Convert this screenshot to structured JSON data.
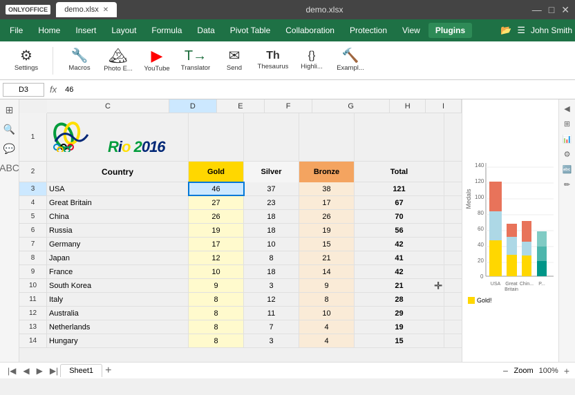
{
  "titlebar": {
    "logo": "ONLYOFFICE",
    "tab_label": "demo.xlsx",
    "title": "demo.xlsx",
    "min": "—",
    "max": "□",
    "close": "✕"
  },
  "menubar": {
    "items": [
      "File",
      "Home",
      "Insert",
      "Layout",
      "Formula",
      "Data",
      "Pivot Table",
      "Collaboration",
      "Protection",
      "View",
      "Plugins"
    ],
    "active": "Plugins",
    "user": "John Smith"
  },
  "toolbar": {
    "buttons": [
      {
        "name": "settings",
        "icon": "⚙",
        "label": "Settings"
      },
      {
        "name": "macros",
        "icon": "🔧",
        "label": "Macros"
      },
      {
        "name": "photo-editor",
        "icon": "🖼",
        "label": "Photo E..."
      },
      {
        "name": "youtube",
        "icon": "▶",
        "label": "YouTube"
      },
      {
        "name": "translator",
        "icon": "T→",
        "label": "Translator"
      },
      {
        "name": "send",
        "icon": "✉",
        "label": "Send"
      },
      {
        "name": "thesaurus",
        "icon": "Th",
        "label": "Thesaurus"
      },
      {
        "name": "highlight",
        "icon": "{}",
        "label": "Highli..."
      },
      {
        "name": "example",
        "icon": "🔨",
        "label": "Exampl..."
      }
    ]
  },
  "formula_bar": {
    "cell_ref": "D3",
    "fx": "fx",
    "formula": "46"
  },
  "columns": {
    "headers": [
      "C",
      "D",
      "E",
      "F",
      "G",
      "H",
      "I"
    ],
    "widths": [
      205,
      80,
      80,
      80,
      80,
      60,
      60
    ]
  },
  "rows": [
    {
      "num": "1",
      "special": "logo"
    },
    {
      "num": "2",
      "special": "header",
      "cells": [
        "Country",
        "Gold",
        "Silver",
        "Bronze",
        "Total"
      ]
    },
    {
      "num": "3",
      "cells": [
        "USA",
        "46",
        "37",
        "38",
        "121"
      ]
    },
    {
      "num": "4",
      "cells": [
        "Great Britain",
        "27",
        "23",
        "17",
        "67"
      ]
    },
    {
      "num": "5",
      "cells": [
        "China",
        "26",
        "18",
        "26",
        "70"
      ]
    },
    {
      "num": "6",
      "cells": [
        "Russia",
        "19",
        "18",
        "19",
        "56"
      ]
    },
    {
      "num": "7",
      "cells": [
        "Germany",
        "17",
        "10",
        "15",
        "42"
      ]
    },
    {
      "num": "8",
      "cells": [
        "Japan",
        "12",
        "8",
        "21",
        "41"
      ]
    },
    {
      "num": "9",
      "cells": [
        "France",
        "10",
        "18",
        "14",
        "42"
      ]
    },
    {
      "num": "10",
      "cells": [
        "South Korea",
        "9",
        "3",
        "9",
        "21"
      ]
    },
    {
      "num": "11",
      "cells": [
        "Italy",
        "8",
        "12",
        "8",
        "28"
      ]
    },
    {
      "num": "12",
      "cells": [
        "Australia",
        "8",
        "11",
        "10",
        "29"
      ]
    },
    {
      "num": "13",
      "cells": [
        "Netherlands",
        "8",
        "7",
        "4",
        "19"
      ]
    },
    {
      "num": "14",
      "cells": [
        "Hungary",
        "8",
        "3",
        "4",
        "15"
      ]
    }
  ],
  "sheet_tab": "Sheet1",
  "zoom": "100%",
  "chart": {
    "title": "Medals",
    "y_max": 140,
    "y_labels": [
      "0",
      "20",
      "40",
      "60",
      "80",
      "100",
      "120",
      "140"
    ],
    "x_labels": [
      "USA",
      "Great Britain",
      "Chin...",
      "P..."
    ],
    "legend": [
      "Gold!",
      ""
    ]
  }
}
